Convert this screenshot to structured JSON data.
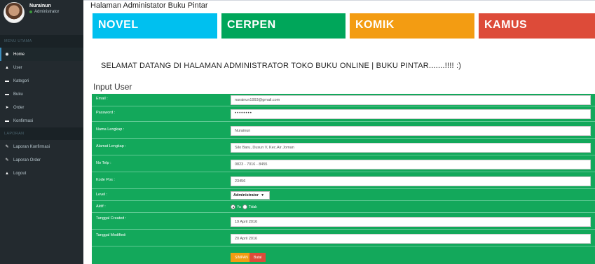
{
  "sidebar": {
    "user_name": "Nurainun",
    "user_role": "Administrator",
    "section_main": "MENU UTAMA",
    "section_report": "LAPORAN",
    "main_items": [
      {
        "label": "Home",
        "icon": "dashboard-icon"
      },
      {
        "label": "User",
        "icon": "user-icon"
      },
      {
        "label": "Kategori",
        "icon": "folder-icon"
      },
      {
        "label": "Buku",
        "icon": "folder-icon"
      },
      {
        "label": "Order",
        "icon": "send-icon"
      },
      {
        "label": "Konfirmasi",
        "icon": "folder-icon"
      }
    ],
    "report_items": [
      {
        "label": "Laporan Konfirmasi",
        "icon": "edit-icon"
      },
      {
        "label": "Laporan Order",
        "icon": "edit-icon"
      },
      {
        "label": "Logout",
        "icon": "user-icon"
      }
    ]
  },
  "header": {
    "title": "Halaman Administator Buku Pintar"
  },
  "categories": [
    {
      "label": "NOVEL",
      "color": "#00c0ef"
    },
    {
      "label": "CERPEN",
      "color": "#00a65a"
    },
    {
      "label": "KOMIK",
      "color": "#f39c12"
    },
    {
      "label": "KAMUS",
      "color": "#dd4b39"
    }
  ],
  "welcome_text": "SELAMAT DATANG DI HALAMAN ADMINISTRATOR TOKO BUKU ONLINE | BUKU PINTAR.......!!!! :)",
  "form": {
    "heading": "Input User",
    "email_label": "Email :",
    "email_value": "nurainun1993@gmail.com",
    "password_label": "Password :",
    "password_value": "••••••••",
    "name_label": "Nama Lengkap :",
    "name_value": "Nurainun",
    "address_label": "Alamat Lengkap :",
    "address_value": "Silo Baru, Dusun V, Kec.Air Joman",
    "phone_label": "No Telp :",
    "phone_value": "0823 - 7016 - 8455",
    "postal_label": "Kode Pos :",
    "postal_value": "23456",
    "level_label": "Level :",
    "level_value": "Administrator",
    "active_label": "Aktif :",
    "active_yes": "Ya",
    "active_no": "Tidak",
    "created_label": "Tanggal Created :",
    "created_value": "19 April 2016",
    "modified_label": "Tanggal Modified:",
    "modified_value": "20 April 2016",
    "save_label": "SIMPAN",
    "cancel_label": "Batal"
  }
}
